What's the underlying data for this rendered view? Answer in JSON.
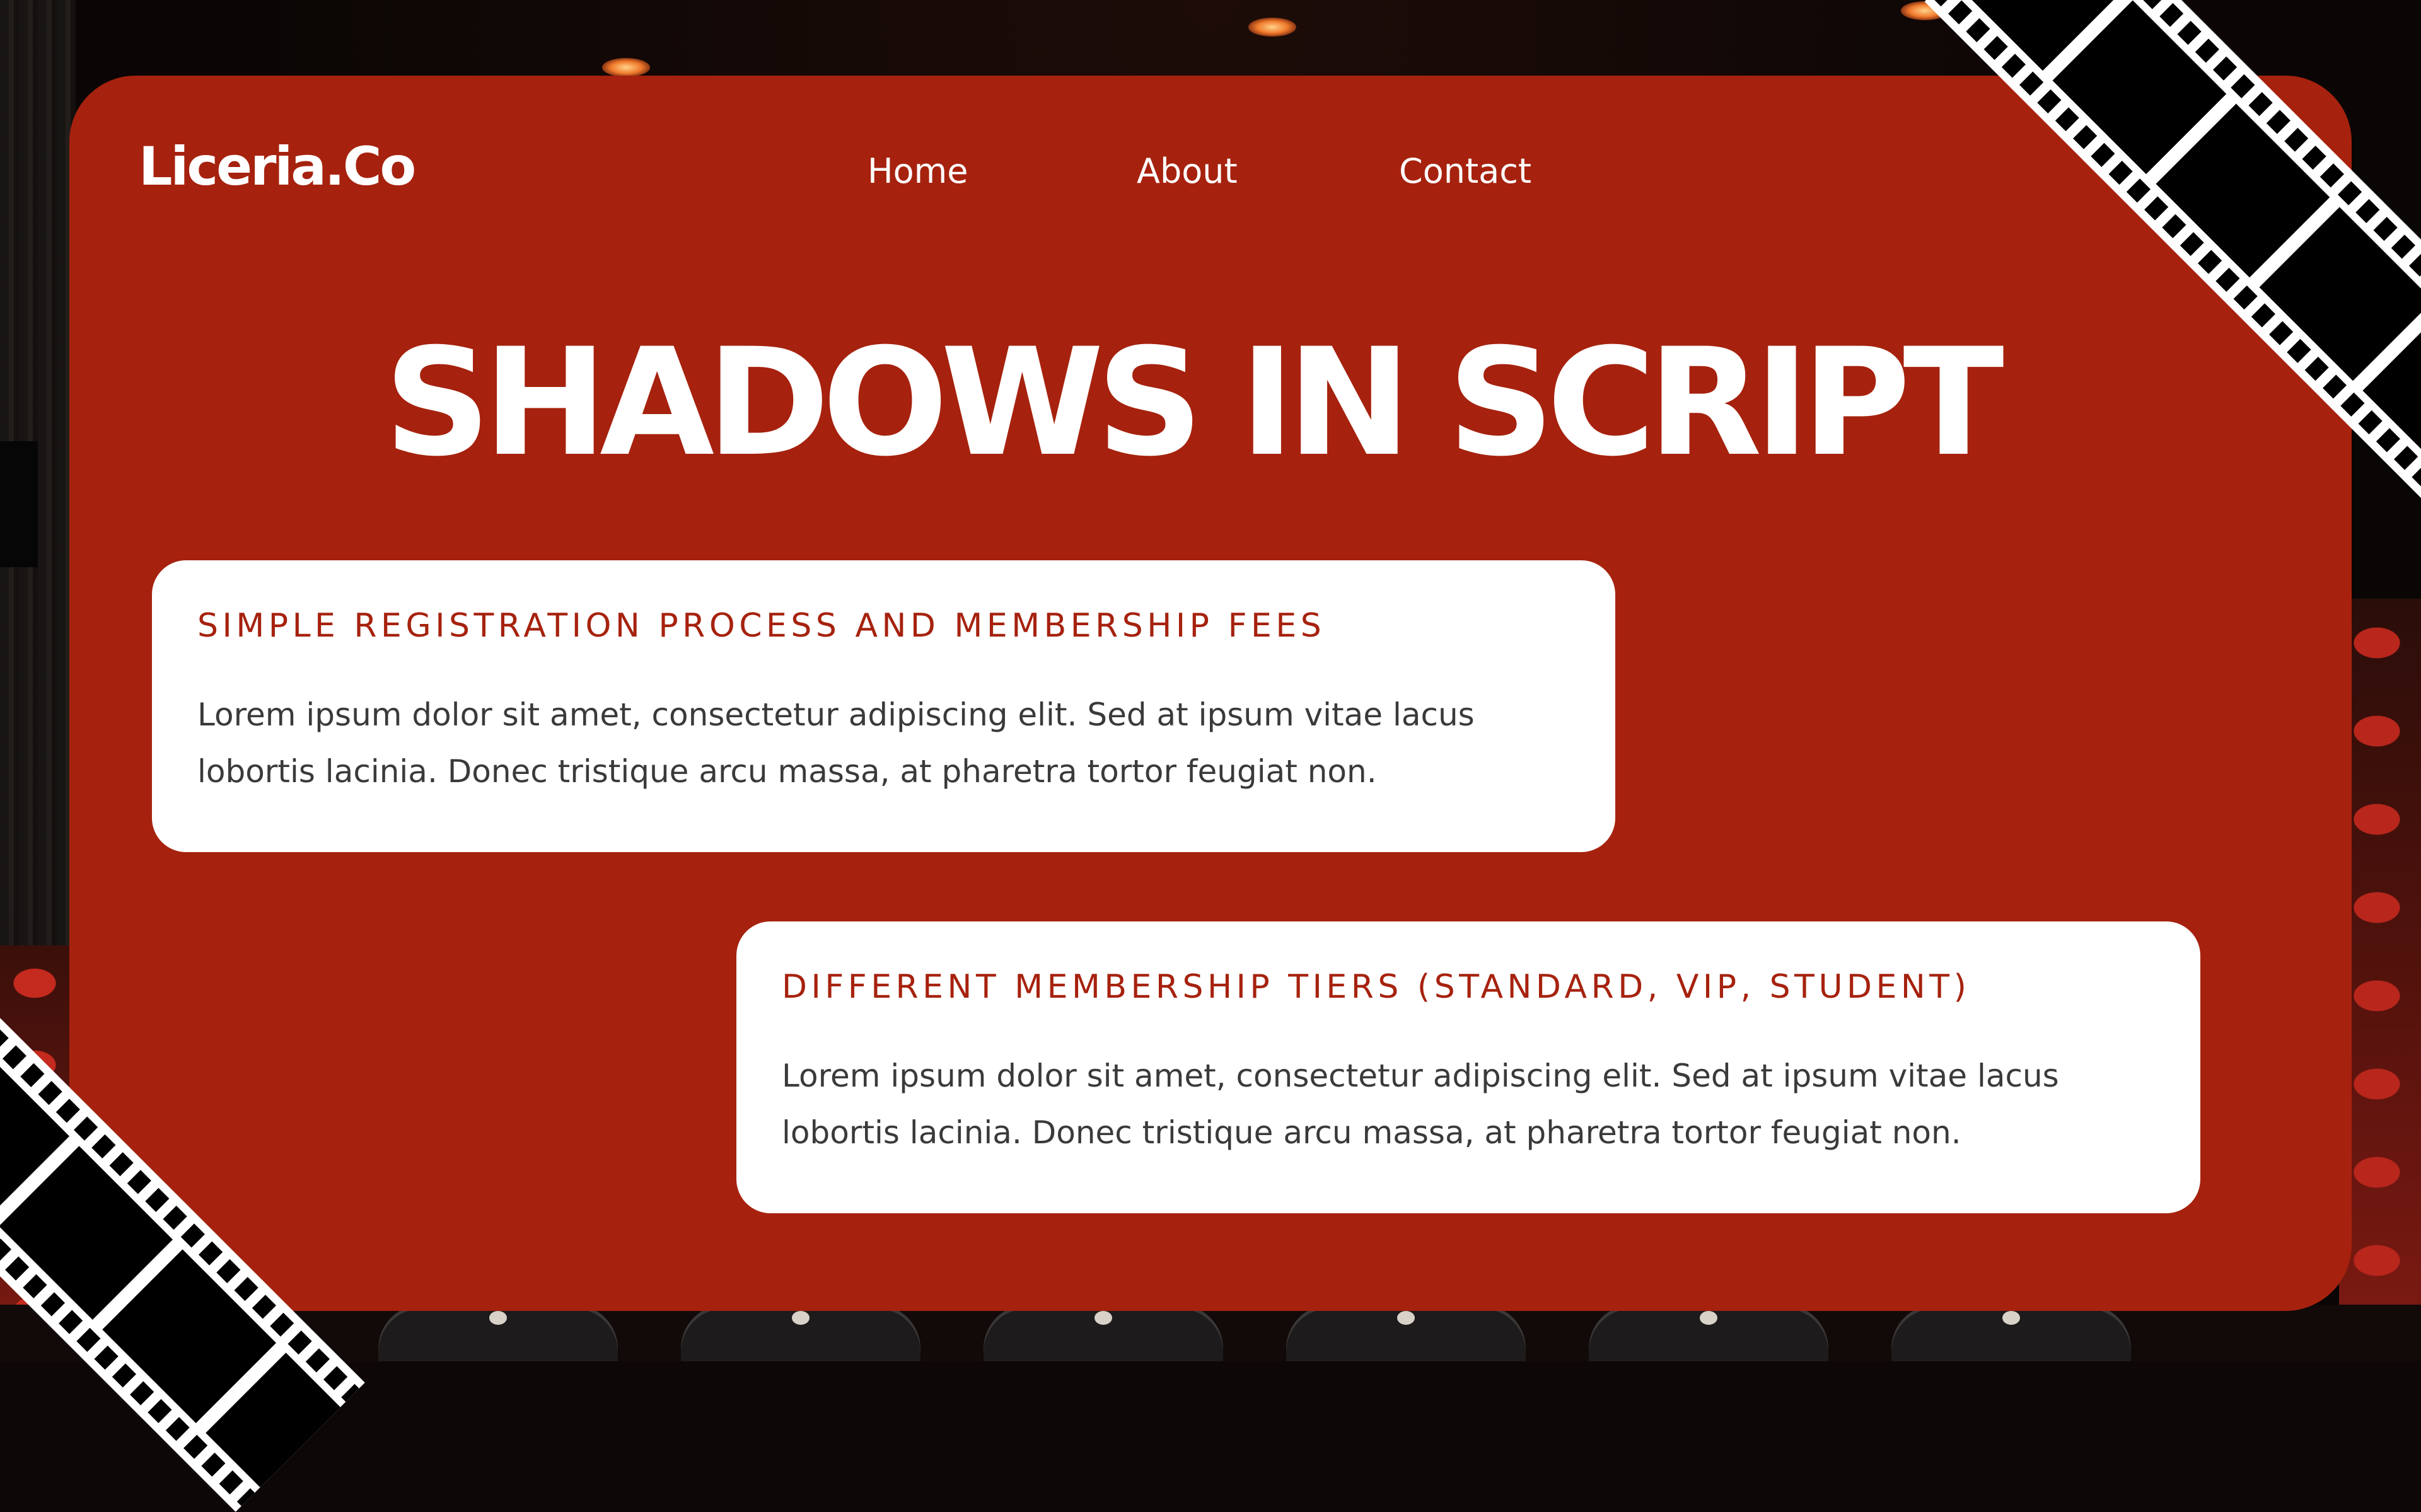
{
  "brand": {
    "logo_text": "Liceria.Co"
  },
  "nav": {
    "items": [
      {
        "label": "Home"
      },
      {
        "label": "About"
      },
      {
        "label": "Contact"
      }
    ]
  },
  "hero": {
    "title": "SHADOWS IN SCRIPT"
  },
  "cards": [
    {
      "title": "SIMPLE REGISTRATION PROCESS AND MEMBERSHIP FEES",
      "body": "Lorem ipsum dolor sit amet, consectetur adipiscing elit. Sed at ipsum vitae lacus lobortis lacinia. Donec tristique arcu massa, at pharetra tortor feugiat non."
    },
    {
      "title": "DIFFERENT MEMBERSHIP TIERS (STANDARD, VIP, STUDENT)",
      "body": "Lorem ipsum dolor sit amet, consectetur adipiscing elit. Sed at ipsum vitae lacus lobortis lacinia. Donec tristique arcu massa, at pharetra tortor feugiat non."
    }
  ],
  "theme": {
    "panel_color": "#a6220e",
    "card_color": "#ffffff",
    "accent_text": "#a6220e",
    "body_text": "#3a3a3a"
  },
  "decorations": {
    "background": "cinema-seats-photo",
    "film_strip_icon": "film-strip-icon"
  }
}
